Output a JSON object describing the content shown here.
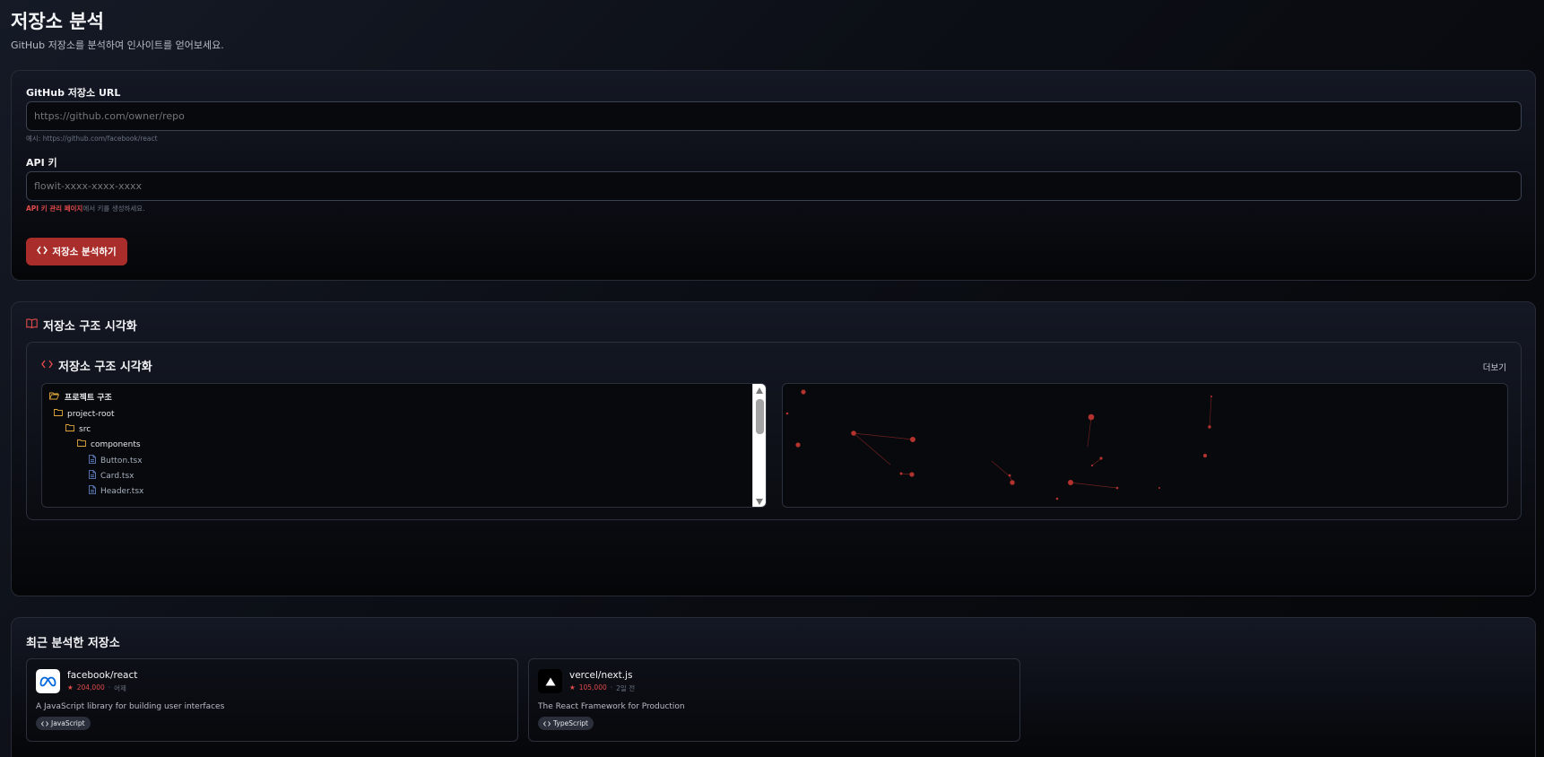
{
  "header": {
    "title": "저장소 분석",
    "subtitle": "GitHub 저장소를 분석하여 인사이트를 얻어보세요."
  },
  "form": {
    "url_label": "GitHub 저장소 URL",
    "url_placeholder": "https://github.com/owner/repo",
    "url_hint": "예시: https://github.com/facebook/react",
    "apikey_label": "API 키",
    "apikey_placeholder": "flowit-xxxx-xxxx-xxxx",
    "apikey_hint_link": "API 키 관리 페이지",
    "apikey_hint_rest": "에서 키를 생성하세요.",
    "analyze_button": "저장소 분석하기"
  },
  "visualization": {
    "section_title": "저장소 구조 시각화",
    "inner_title": "저장소 구조 시각화",
    "more_link": "더보기",
    "tree_header": "프로젝트 구조",
    "tree": [
      {
        "label": "project-root",
        "type": "folder",
        "depth": 0
      },
      {
        "label": "src",
        "type": "folder",
        "depth": 1
      },
      {
        "label": "components",
        "type": "folder",
        "depth": 2
      },
      {
        "label": "Button.tsx",
        "type": "file",
        "depth": 3
      },
      {
        "label": "Card.tsx",
        "type": "file",
        "depth": 3
      },
      {
        "label": "Header.tsx",
        "type": "file",
        "depth": 3
      }
    ]
  },
  "recent": {
    "title": "최근 분석한 저장소",
    "repos": [
      {
        "name": "facebook/react",
        "stars": "204,000",
        "time": "어제",
        "description": "A JavaScript library for building user interfaces",
        "language": "JavaScript"
      },
      {
        "name": "vercel/next.js",
        "stars": "105,000",
        "time": "2일 전",
        "description": "The React Framework for Production",
        "language": "TypeScript"
      }
    ]
  },
  "colors": {
    "accent": "#a92e2b",
    "accent_text": "#e04a4a",
    "folder_icon": "#e0a83a",
    "file_icon": "#6b8ed6"
  },
  "icons": {
    "analyze_button": "code-brackets-icon",
    "section": "book-open-icon",
    "inner": "code-brackets-icon",
    "tree_folder": "folder-icon",
    "tree_file": "file-icon",
    "star": "star-icon"
  }
}
